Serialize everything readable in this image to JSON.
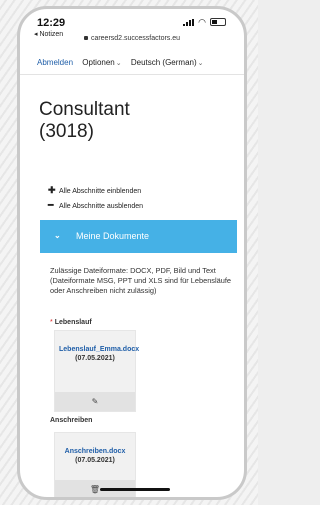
{
  "status_bar": {
    "time": "12:29",
    "back_app": "◂ Notizen",
    "url": "careersd2.successfactors.eu"
  },
  "nav": {
    "logout": "Abmelden",
    "options": "Optionen",
    "language": "Deutsch (German)"
  },
  "page": {
    "title_line1": "Consultant",
    "title_line2": "(3018)"
  },
  "controls": {
    "expand_all": "Alle Abschnitte einblenden",
    "collapse_all": "Alle Abschnitte ausblenden"
  },
  "section": {
    "title": "Meine Dokumente",
    "formats_text": "Zulässige Dateiformate: DOCX, PDF, Bild und Text (Dateiformate MSG, PPT und XLS sind für Lebensläufe oder Anschreiben nicht zulässig)"
  },
  "resume": {
    "label": "Lebenslauf",
    "required_marker": "*",
    "file_name": "Lebenslauf_Emma.docx",
    "date": "(07.05.2021)"
  },
  "cover_letter": {
    "label": "Anschreiben",
    "file_name": "Anschreiben.docx",
    "date": "(07.05.2021)"
  },
  "colors": {
    "accent": "#45b1e6",
    "link": "#1f5ea8"
  },
  "icons": {
    "resume_action": "pencil-icon",
    "cover_action": "trash-icon"
  }
}
